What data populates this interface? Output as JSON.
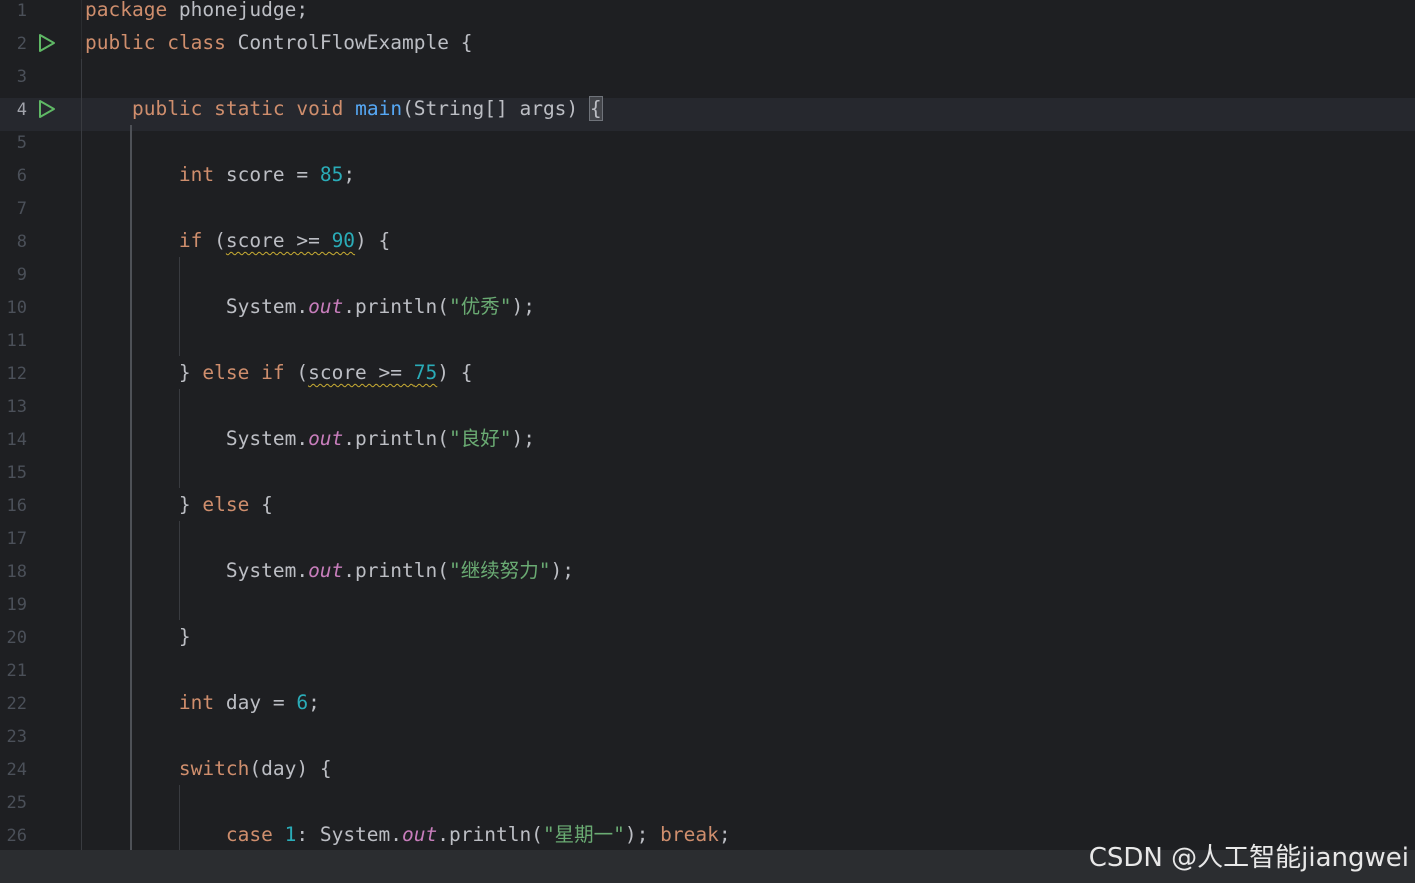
{
  "editor": {
    "lines": [
      {
        "n": "1",
        "segs": [
          [
            "kw",
            "package"
          ],
          [
            "t",
            " phonejudge;"
          ]
        ]
      },
      {
        "n": "2",
        "run": true,
        "segs": [
          [
            "kw",
            "public"
          ],
          [
            "t",
            " "
          ],
          [
            "kw",
            "class"
          ],
          [
            "t",
            " ControlFlowExample {"
          ]
        ]
      },
      {
        "n": "3",
        "segs": []
      },
      {
        "n": "4",
        "run": true,
        "current": true,
        "segs": [
          [
            "t",
            "    "
          ],
          [
            "kw",
            "public"
          ],
          [
            "t",
            " "
          ],
          [
            "kw",
            "static"
          ],
          [
            "t",
            " "
          ],
          [
            "kw",
            "void"
          ],
          [
            "t",
            " "
          ],
          [
            "fn",
            "main"
          ],
          [
            "t",
            "(String[] args) "
          ],
          [
            "hl",
            "{"
          ]
        ]
      },
      {
        "n": "5",
        "segs": []
      },
      {
        "n": "6",
        "segs": [
          [
            "t",
            "        "
          ],
          [
            "kw",
            "int"
          ],
          [
            "t",
            " score = "
          ],
          [
            "num",
            "85"
          ],
          [
            "t",
            ";"
          ]
        ]
      },
      {
        "n": "7",
        "segs": []
      },
      {
        "n": "8",
        "segs": [
          [
            "t",
            "        "
          ],
          [
            "kw",
            "if"
          ],
          [
            "t",
            " ("
          ],
          [
            "sq",
            "score >= "
          ],
          [
            "sqnum",
            "90"
          ],
          [
            "t",
            ") {"
          ]
        ]
      },
      {
        "n": "9",
        "segs": []
      },
      {
        "n": "10",
        "segs": [
          [
            "t",
            "            System."
          ],
          [
            "fld",
            "out"
          ],
          [
            "t",
            ".println("
          ],
          [
            "str",
            "\"优秀\""
          ],
          [
            "t",
            ");"
          ]
        ]
      },
      {
        "n": "11",
        "segs": []
      },
      {
        "n": "12",
        "segs": [
          [
            "t",
            "        } "
          ],
          [
            "kw",
            "else"
          ],
          [
            "t",
            " "
          ],
          [
            "kw",
            "if"
          ],
          [
            "t",
            " ("
          ],
          [
            "sq",
            "score >= "
          ],
          [
            "sqnum",
            "75"
          ],
          [
            "t",
            ") {"
          ]
        ]
      },
      {
        "n": "13",
        "segs": []
      },
      {
        "n": "14",
        "segs": [
          [
            "t",
            "            System."
          ],
          [
            "fld",
            "out"
          ],
          [
            "t",
            ".println("
          ],
          [
            "str",
            "\"良好\""
          ],
          [
            "t",
            ");"
          ]
        ]
      },
      {
        "n": "15",
        "segs": []
      },
      {
        "n": "16",
        "segs": [
          [
            "t",
            "        } "
          ],
          [
            "kw",
            "else"
          ],
          [
            "t",
            " {"
          ]
        ]
      },
      {
        "n": "17",
        "segs": []
      },
      {
        "n": "18",
        "segs": [
          [
            "t",
            "            System."
          ],
          [
            "fld",
            "out"
          ],
          [
            "t",
            ".println("
          ],
          [
            "str",
            "\"继续努力\""
          ],
          [
            "t",
            ");"
          ]
        ]
      },
      {
        "n": "19",
        "segs": []
      },
      {
        "n": "20",
        "segs": [
          [
            "t",
            "        }"
          ]
        ]
      },
      {
        "n": "21",
        "segs": []
      },
      {
        "n": "22",
        "segs": [
          [
            "t",
            "        "
          ],
          [
            "kw",
            "int"
          ],
          [
            "t",
            " day = "
          ],
          [
            "num",
            "6"
          ],
          [
            "t",
            ";"
          ]
        ]
      },
      {
        "n": "23",
        "segs": []
      },
      {
        "n": "24",
        "segs": [
          [
            "t",
            "        "
          ],
          [
            "kw",
            "switch"
          ],
          [
            "t",
            "(day) {"
          ]
        ]
      },
      {
        "n": "25",
        "segs": []
      },
      {
        "n": "26",
        "segs": [
          [
            "t",
            "            "
          ],
          [
            "kw",
            "case"
          ],
          [
            "t",
            " "
          ],
          [
            "num",
            "1"
          ],
          [
            "t",
            ": System."
          ],
          [
            "fld",
            "out"
          ],
          [
            "t",
            ".println("
          ],
          [
            "str",
            "\"星期一\""
          ],
          [
            "t",
            "); "
          ],
          [
            "kw",
            "break"
          ],
          [
            "t",
            ";"
          ]
        ]
      }
    ]
  },
  "watermark": "CSDN @人工智能jiangwei",
  "colors": {
    "background": "#1e1f22",
    "keyword": "#cf8e6d",
    "number": "#2aacb8",
    "string": "#6aab73",
    "field": "#c77dbb",
    "method": "#56a8f5",
    "run_icon": "#5fb865"
  },
  "icons": {
    "run": "run-gutter-icon"
  }
}
